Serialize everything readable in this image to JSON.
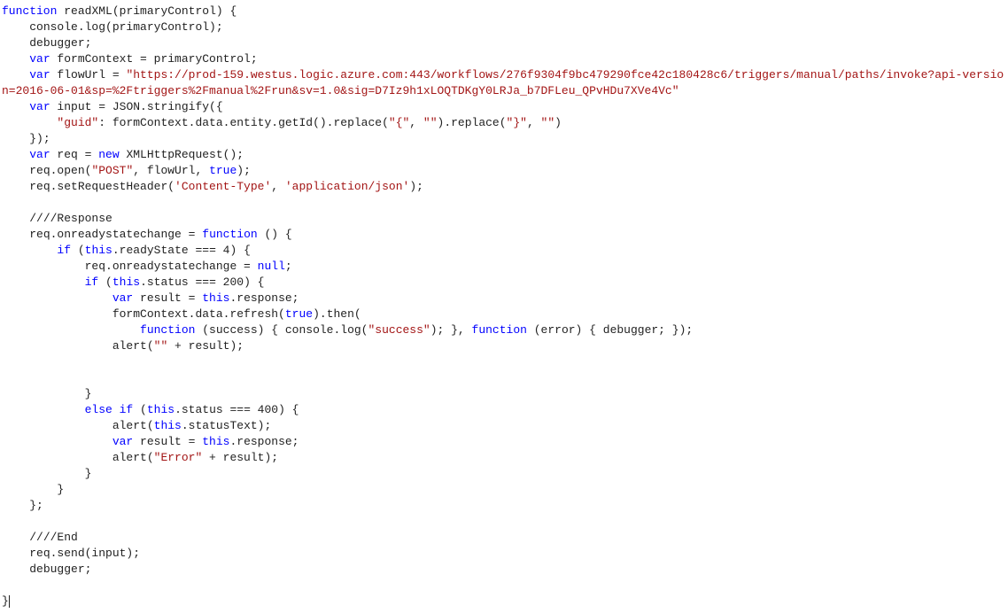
{
  "code": {
    "fnName": "readXML",
    "param": "primaryControl",
    "l2": "    console.log(primaryControl);",
    "l3": "    debugger;",
    "l4_pre": "    ",
    "l4_kw": "var",
    "l4_rest": " formContext = primaryControl;",
    "l5_pre": "    ",
    "l5_kw": "var",
    "l5_mid": " flowUrl = ",
    "l5_str": "\"https://prod-159.westus.logic.azure.com:443/workflows/276f9304f9bc479290fce42c180428c6/triggers/manual/paths/invoke?api-version=2016-06-01&sp=%2Ftriggers%2Fmanual%2Frun&sv=1.0&sig=D7Iz9h1xLOQTDKgY0LRJa_b7DFLeu_QPvHDu7XVe4Vc\"",
    "l6_pre": "    ",
    "l6_kw": "var",
    "l6_rest": " input = JSON.stringify({",
    "l7_pre": "        ",
    "l7_key": "\"guid\"",
    "l7_mid": ": formContext.data.entity.getId().replace(",
    "l7_s1": "\"{\"",
    "l7_c1": ", ",
    "l7_s2": "\"\"",
    "l7_c2": ").replace(",
    "l7_s3": "\"}\"",
    "l7_c3": ", ",
    "l7_s4": "\"\"",
    "l7_end": ")",
    "l8": "    });",
    "l9_pre": "    ",
    "l9_kw": "var",
    "l9_mid": " req = ",
    "l9_kw2": "new",
    "l9_rest": " XMLHttpRequest();",
    "l10_pre": "    req.open(",
    "l10_s1": "\"POST\"",
    "l10_mid": ", flowUrl, ",
    "l10_kw": "true",
    "l10_end": ");",
    "l11_pre": "    req.setRequestHeader(",
    "l11_s1": "'Content-Type'",
    "l11_c": ", ",
    "l11_s2": "'application/json'",
    "l11_end": ");",
    "blank": "",
    "l13": "    ////Response",
    "l14_pre": "    req.onreadystatechange = ",
    "l14_kw": "function",
    "l14_end": " () {",
    "l15_pre": "        ",
    "l15_kw": "if",
    "l15_mid": " (",
    "l15_kw2": "this",
    "l15_end": ".readyState === 4) {",
    "l16_pre": "            req.onreadystatechange = ",
    "l16_kw": "null",
    "l16_end": ";",
    "l17_pre": "            ",
    "l17_kw": "if",
    "l17_mid": " (",
    "l17_kw2": "this",
    "l17_end": ".status === 200) {",
    "l18_pre": "                ",
    "l18_kw": "var",
    "l18_mid": " result = ",
    "l18_kw2": "this",
    "l18_end": ".response;",
    "l19_pre": "                formContext.data.refresh(",
    "l19_kw": "true",
    "l19_end": ").then(",
    "l20_pre": "                    ",
    "l20_kw": "function",
    "l20_mid": " (success) { console.log(",
    "l20_s": "\"success\"",
    "l20_mid2": "); }, ",
    "l20_kw2": "function",
    "l20_end": " (error) { debugger; });",
    "l21_pre": "                alert(",
    "l21_s": "\"\"",
    "l21_end": " + result);",
    "l24": "            }",
    "l25_pre": "            ",
    "l25_kw": "else if",
    "l25_mid": " (",
    "l25_kw2": "this",
    "l25_end": ".status === 400) {",
    "l26_pre": "                alert(",
    "l26_kw": "this",
    "l26_end": ".statusText);",
    "l27_pre": "                ",
    "l27_kw": "var",
    "l27_mid": " result = ",
    "l27_kw2": "this",
    "l27_end": ".response;",
    "l28_pre": "                alert(",
    "l28_s": "\"Error\"",
    "l28_end": " + result);",
    "l29": "            }",
    "l30": "        }",
    "l31": "    };",
    "l33": "    ////End",
    "l34": "    req.send(input);",
    "l35": "    debugger;",
    "l37": "}"
  }
}
